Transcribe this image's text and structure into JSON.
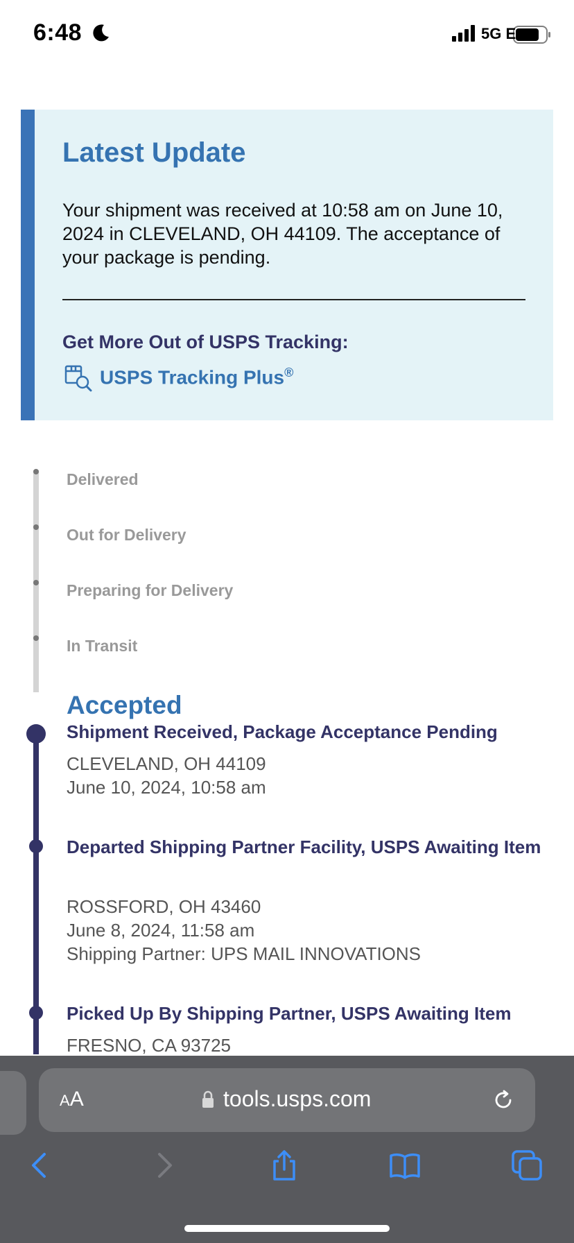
{
  "status_bar": {
    "time": "6:48",
    "network": "5G E"
  },
  "latest_update": {
    "title": "Latest Update",
    "body": "Your shipment was received at 10:58 am on June 10, 2024 in CLEVELAND, OH 44109. The acceptance of your package is pending.",
    "more_label": "Get More Out of USPS Tracking:",
    "plus_link": "USPS Tracking Plus",
    "plus_mark": "®",
    "accent_color": "#3a73b7",
    "background_color": "#e4f3f7"
  },
  "timeline": {
    "pending_steps": [
      "Delivered",
      "Out for Delivery",
      "Preparing for Delivery",
      "In Transit"
    ],
    "current_status": "Accepted",
    "events": [
      {
        "title": "Shipment Received, Package Acceptance Pending",
        "location": "CLEVELAND, OH 44109",
        "datetime": "June 10, 2024, 10:58 am"
      },
      {
        "title": "Departed Shipping Partner Facility, USPS Awaiting Item",
        "location": "ROSSFORD, OH 43460",
        "datetime": "June 8, 2024, 11:58 am",
        "note": "Shipping Partner: UPS MAIL INNOVATIONS"
      },
      {
        "title": "Picked Up By Shipping Partner, USPS Awaiting Item",
        "location": "FRESNO, CA 93725"
      }
    ],
    "navy_color": "#333366"
  },
  "browser": {
    "text_size_small": "A",
    "text_size_large": "A",
    "url": "tools.usps.com",
    "toolbar_icons": [
      "back-icon",
      "forward-icon",
      "share-icon",
      "bookmarks-icon",
      "tabs-icon"
    ]
  }
}
